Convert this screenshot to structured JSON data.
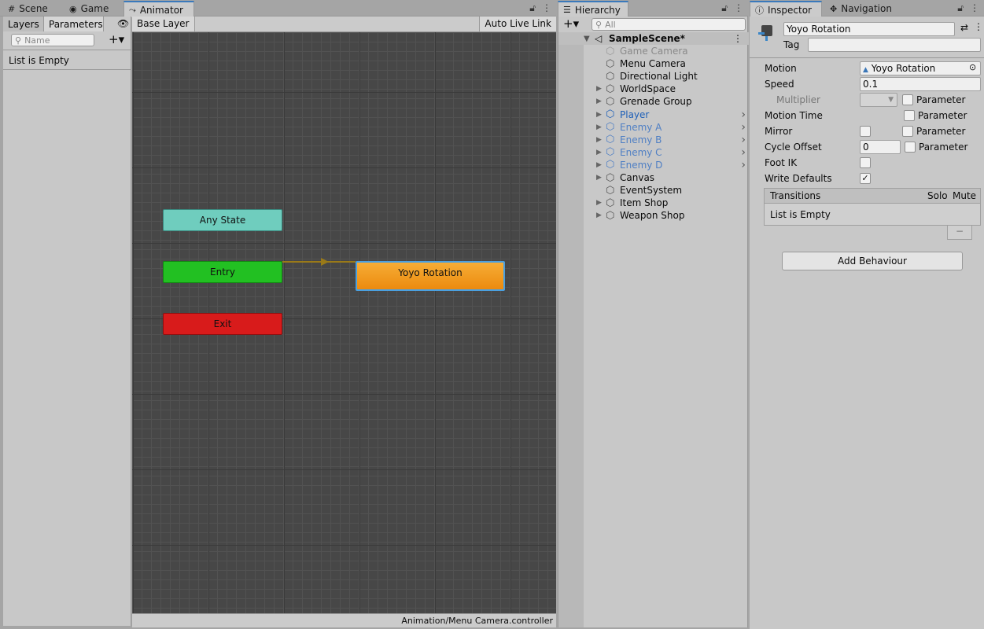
{
  "tabs_left": [
    {
      "label": "Scene",
      "icon": "grid-icon"
    },
    {
      "label": "Game",
      "icon": "gamepad-icon"
    },
    {
      "label": "Animator",
      "icon": "animator-icon"
    }
  ],
  "params_panel": {
    "layers_tab": "Layers",
    "parameters_tab": "Parameters",
    "search_placeholder": "Name",
    "empty_text": "List is Empty"
  },
  "animator": {
    "breadcrumb": "Base Layer",
    "auto_live_link": "Auto Live Link",
    "nodes": {
      "any_state": "Any State",
      "entry": "Entry",
      "exit": "Exit",
      "default_state": "Yoyo Rotation"
    },
    "status": "Animation/Menu Camera.controller"
  },
  "hierarchy": {
    "tab_label": "Hierarchy",
    "search_placeholder": "All",
    "scene_name": "SampleScene*",
    "items": [
      {
        "label": "Game Camera",
        "expandable": false,
        "style": "disabled",
        "arrow": false
      },
      {
        "label": "Menu Camera",
        "expandable": false,
        "style": "normal",
        "arrow": false
      },
      {
        "label": "Directional Light",
        "expandable": false,
        "style": "normal",
        "arrow": false
      },
      {
        "label": "WorldSpace",
        "expandable": true,
        "style": "normal",
        "arrow": false
      },
      {
        "label": "Grenade Group",
        "expandable": true,
        "style": "normal",
        "arrow": false
      },
      {
        "label": "Player",
        "expandable": true,
        "style": "prefab",
        "arrow": true
      },
      {
        "label": "Enemy A",
        "expandable": true,
        "style": "prefab-light",
        "arrow": true
      },
      {
        "label": "Enemy B",
        "expandable": true,
        "style": "prefab-light",
        "arrow": true
      },
      {
        "label": "Enemy C",
        "expandable": true,
        "style": "prefab-light",
        "arrow": true
      },
      {
        "label": "Enemy D",
        "expandable": true,
        "style": "prefab-light",
        "arrow": true
      },
      {
        "label": "Canvas",
        "expandable": true,
        "style": "normal",
        "arrow": false
      },
      {
        "label": "EventSystem",
        "expandable": false,
        "style": "normal",
        "arrow": false
      },
      {
        "label": "Item Shop",
        "expandable": true,
        "style": "normal",
        "arrow": false
      },
      {
        "label": "Weapon Shop",
        "expandable": true,
        "style": "normal",
        "arrow": false
      }
    ]
  },
  "inspector": {
    "tab_label": "Inspector",
    "nav_tab_label": "Navigation",
    "object_name": "Yoyo Rotation",
    "tag_label": "Tag",
    "motion_label": "Motion",
    "motion_value": "Yoyo Rotation",
    "speed_label": "Speed",
    "speed_value": "0.1",
    "multiplier_label": "Multiplier",
    "parameter_label": "Parameter",
    "motion_time_label": "Motion Time",
    "mirror_label": "Mirror",
    "cycle_offset_label": "Cycle Offset",
    "cycle_offset_value": "0",
    "foot_ik_label": "Foot IK",
    "write_defaults_label": "Write Defaults",
    "transitions_label": "Transitions",
    "solo_label": "Solo",
    "mute_label": "Mute",
    "transitions_empty": "List is Empty",
    "remove_label": "−",
    "add_behaviour": "Add Behaviour",
    "checkmark": "✓"
  },
  "colors": {
    "any_state": "#6fcdbe",
    "entry": "#22c022",
    "exit": "#d81b1b",
    "default_state": "#f29b1c",
    "prefab_blue": "#1d5fb8",
    "prefab_light": "#4f7fc4"
  }
}
